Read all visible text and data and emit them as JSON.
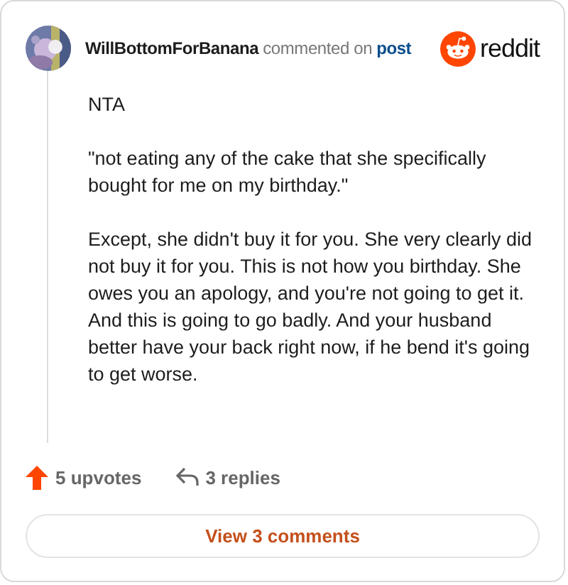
{
  "header": {
    "username": "WillBottomForBanana",
    "action": "commented on",
    "link": "post",
    "brand": "reddit"
  },
  "comment": {
    "paragraphs": [
      "NTA",
      "\"not eating any of the cake that she specifically bought for me on my birthday.\"",
      "Except, she didn't buy it for you. She very clearly did not buy it for you. This is not how you birthday. She owes you an apology, and you're not going to get it. And this is going to go badly. And your husband better have your back right now, if he bend it's going to get worse."
    ]
  },
  "footer": {
    "upvotes": "5 upvotes",
    "replies": "3 replies"
  },
  "button": {
    "label": "View 3 comments"
  }
}
